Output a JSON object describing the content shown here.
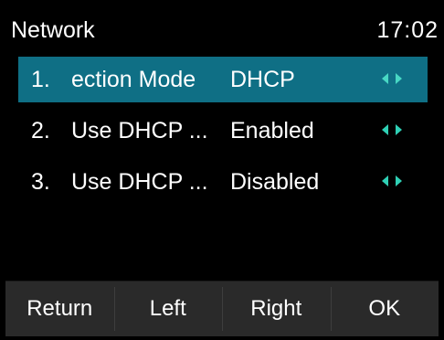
{
  "header": {
    "title": "Network",
    "time": "17:02"
  },
  "list": {
    "items": [
      {
        "number": "1.",
        "label": "ection Mode",
        "value": "DHCP",
        "selected": true
      },
      {
        "number": "2.",
        "label": "Use DHCP ...",
        "value": "Enabled",
        "selected": false
      },
      {
        "number": "3.",
        "label": "Use DHCP ...",
        "value": "Disabled",
        "selected": false
      }
    ]
  },
  "softkeys": {
    "return_label": "Return",
    "left_label": "Left",
    "right_label": "Right",
    "ok_label": "OK"
  },
  "colors": {
    "background": "#000000",
    "selection": "#0f6f85",
    "arrow": "#2fd0b5",
    "softkey_bar": "#2a2a2a"
  },
  "icons": {
    "option_arrows": "left-right-arrow-icon"
  }
}
